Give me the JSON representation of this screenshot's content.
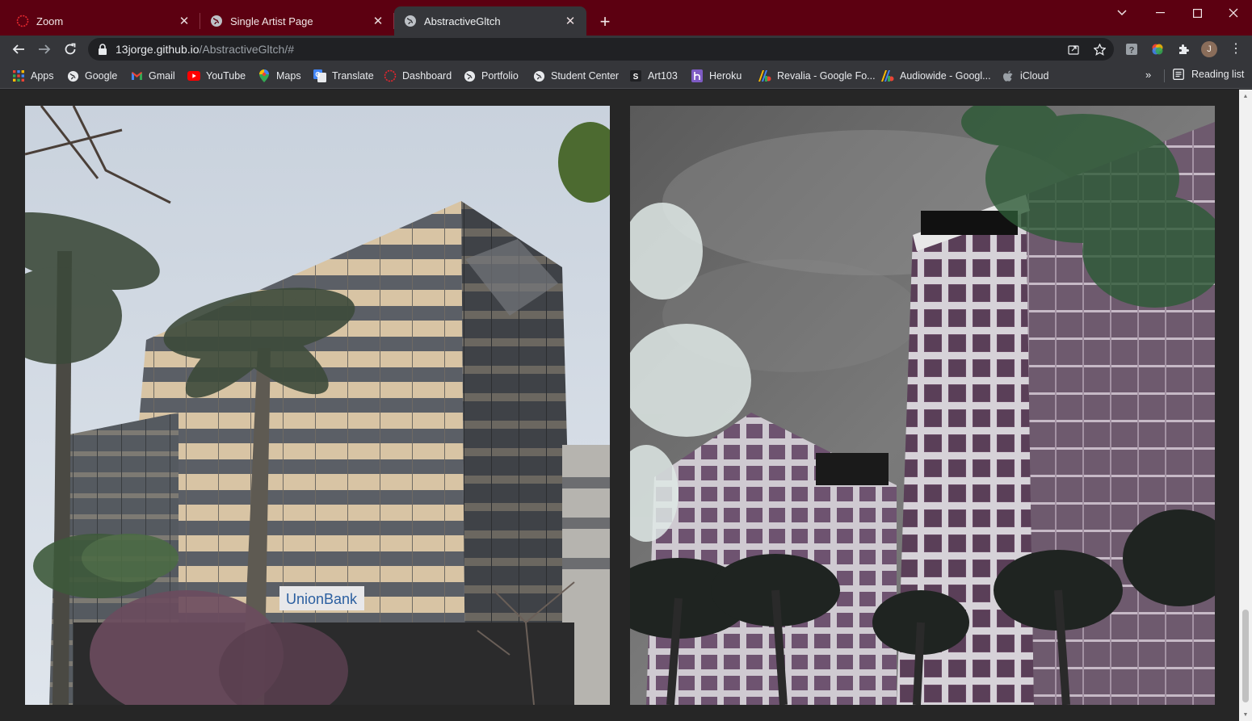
{
  "tabs": [
    {
      "title": "Zoom",
      "icon": "zoom-ring-icon",
      "active": false
    },
    {
      "title": "Single Artist Page",
      "icon": "globe-icon",
      "active": false
    },
    {
      "title": "AbstractiveGltch",
      "icon": "globe-icon",
      "active": true
    }
  ],
  "address": {
    "host": "13jorge.github.io",
    "path": "/AbstractiveGltch/#"
  },
  "bookmarks": [
    {
      "label": "Apps",
      "icon": "apps-grid-icon"
    },
    {
      "label": "Google",
      "icon": "globe-icon"
    },
    {
      "label": "Gmail",
      "icon": "gmail-icon"
    },
    {
      "label": "YouTube",
      "icon": "youtube-icon"
    },
    {
      "label": "Maps",
      "icon": "maps-pin-icon"
    },
    {
      "label": "Translate",
      "icon": "translate-icon"
    },
    {
      "label": "Dashboard",
      "icon": "dashboard-ring-icon"
    },
    {
      "label": "Portfolio",
      "icon": "globe-icon"
    },
    {
      "label": "Student Center",
      "icon": "globe-icon"
    },
    {
      "label": "Art103",
      "icon": "s-letter-icon"
    },
    {
      "label": "Heroku",
      "icon": "heroku-icon"
    },
    {
      "label": "Revalia - Google Fo...",
      "icon": "google-fonts-icon"
    },
    {
      "label": "Audiowide - Googl...",
      "icon": "google-fonts-icon"
    },
    {
      "label": "iCloud",
      "icon": "apple-icon"
    }
  ],
  "reading_list": "Reading list",
  "avatar_initial": "J",
  "photos": {
    "left_sign": "UnionBank"
  },
  "colors": {
    "frame": "#5c0011",
    "toolbar": "#35363a",
    "page_bg": "#262626"
  }
}
